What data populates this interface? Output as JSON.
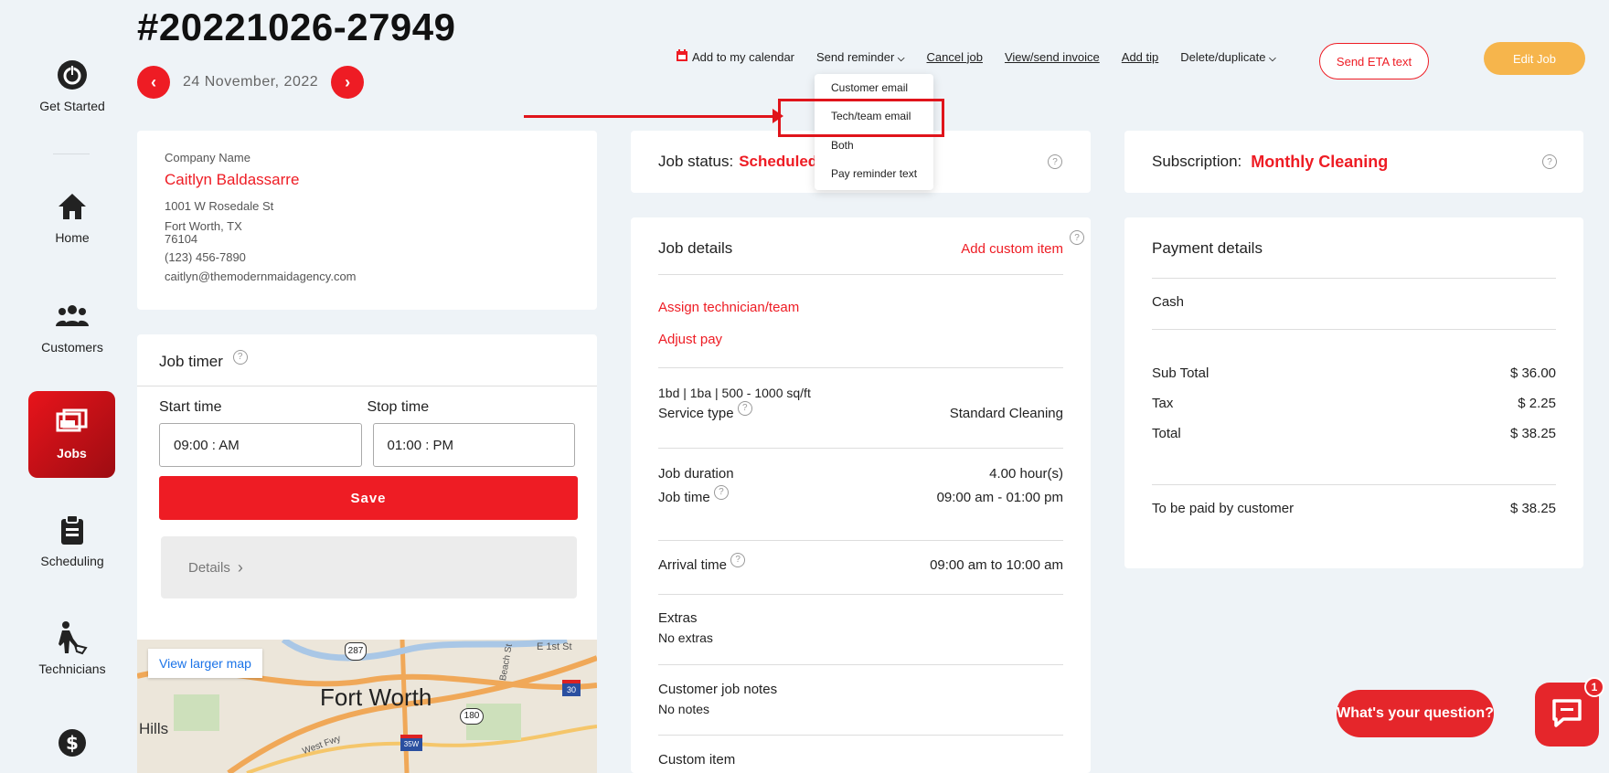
{
  "header": {
    "job_number": "#20221026-27949",
    "date": "24 November, 2022",
    "prev_icon": "chevron-left-icon",
    "next_icon": "chevron-right-icon"
  },
  "sidebar": {
    "items": [
      {
        "label": "Get Started",
        "icon": "power-icon"
      },
      {
        "label": "Home",
        "icon": "home-icon"
      },
      {
        "label": "Customers",
        "icon": "users-icon"
      },
      {
        "label": "Jobs",
        "icon": "jobs-icon",
        "active": true
      },
      {
        "label": "Scheduling",
        "icon": "clipboard-icon"
      },
      {
        "label": "Technicians",
        "icon": "technician-icon"
      },
      {
        "label": "",
        "icon": "dollar-icon"
      }
    ]
  },
  "actions": {
    "calendar": "Add to my calendar",
    "reminder": "Send reminder",
    "cancel": "Cancel job",
    "invoice": "View/send invoice",
    "tip": "Add tip",
    "delete": "Delete/duplicate",
    "eta": "Send ETA text",
    "edit": "Edit Job"
  },
  "reminder_menu": {
    "items": [
      "Customer email",
      "Tech/team email",
      "Both",
      "Pay reminder text"
    ]
  },
  "customer": {
    "label": "Company Name",
    "name": "Caitlyn Baldassarre",
    "street": "1001 W Rosedale St",
    "city": "Fort Worth, TX",
    "zip": "76104",
    "phone": "(123) 456-7890",
    "email": "caitlyn@themodernmaidagency.com"
  },
  "timer": {
    "title": "Job timer",
    "start_label": "Start time",
    "stop_label": "Stop time",
    "start_value": "09:00 : AM",
    "stop_value": "01:00 : PM",
    "save": "Save",
    "details": "Details"
  },
  "map": {
    "link": "View larger map",
    "city": "Fort Worth",
    "hills": "Hills",
    "street": "E 1st St",
    "beach": "Beach St",
    "west": "West Fwy",
    "road1": "287",
    "road2": "30",
    "road3": "180",
    "road4": "35W"
  },
  "status": {
    "label": "Job status:",
    "value": "Scheduled"
  },
  "subscription": {
    "label": "Subscription:",
    "value": "Monthly Cleaning"
  },
  "job_details": {
    "title": "Job details",
    "add_custom": "Add custom item",
    "assign": "Assign technician/team",
    "adjust": "Adjust pay",
    "size": "1bd | 1ba | 500 - 1000 sq/ft",
    "service_label": "Service type",
    "service_value": "Standard Cleaning",
    "duration_label": "Job duration",
    "duration_value": "4.00 hour(s)",
    "time_label": "Job time",
    "time_value": "09:00 am - 01:00 pm",
    "arrival_label": "Arrival time",
    "arrival_value": "09:00 am to 10:00 am",
    "extras_label": "Extras",
    "extras_value": "No extras",
    "notes_label": "Customer job notes",
    "notes_value": "No notes",
    "custom_label": "Custom item"
  },
  "payment": {
    "title": "Payment details",
    "method": "Cash",
    "subtotal_label": "Sub Total",
    "subtotal_value": "$ 36.00",
    "tax_label": "Tax",
    "tax_value": "$ 2.25",
    "total_label": "Total",
    "total_value": "$ 38.25",
    "paid_label": "To be paid by customer",
    "paid_value": "$ 38.25"
  },
  "chat": {
    "question": "What's your question?",
    "badge": "1"
  },
  "colors": {
    "brand_red": "#ee1c24",
    "edit_orange": "#f6b54c",
    "background": "#eef3f7"
  }
}
